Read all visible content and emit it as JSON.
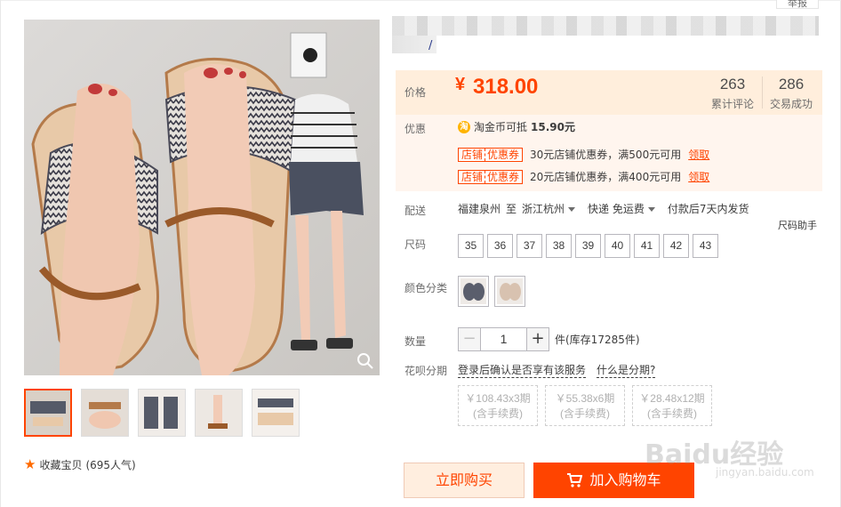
{
  "report": {
    "label": "举报"
  },
  "gallery": {
    "favorite_label": "收藏宝贝",
    "favorite_count": "(695人气)"
  },
  "price": {
    "label": "价格",
    "currency": "¥",
    "value": "318.00",
    "reviews_count": "263",
    "reviews_label": "累计评论",
    "sales_count": "286",
    "sales_label": "交易成功"
  },
  "promo": {
    "label": "优惠",
    "coin_icon_text": "淘",
    "coin_text": "淘金币可抵",
    "coin_amount": "15.90元",
    "coupons": [
      {
        "tag_a": "店铺",
        "tag_b": "优惠券",
        "text": "30元店铺优惠券，满500元可用",
        "action": "领取"
      },
      {
        "tag_a": "店铺",
        "tag_b": "优惠券",
        "text": "20元店铺优惠券，满400元可用",
        "action": "领取"
      }
    ]
  },
  "delivery": {
    "label": "配送",
    "from": "福建泉州",
    "to_word": "至",
    "to": "浙江杭州",
    "method": "快递 免运费",
    "ship_time": "付款后7天内发货",
    "size_helper": "尺码助手"
  },
  "sizes": {
    "label": "尺码",
    "options": [
      "35",
      "36",
      "37",
      "38",
      "39",
      "40",
      "41",
      "42",
      "43"
    ]
  },
  "colors": {
    "label": "颜色分类"
  },
  "quantity": {
    "label": "数量",
    "minus": "−",
    "value": "1",
    "plus": "+",
    "stock": "件(库存17285件)"
  },
  "huabei": {
    "label": "花呗分期",
    "login_text": "登录后确认是否享有该服务",
    "what_text": "什么是分期?",
    "plans": [
      {
        "amount": "￥108.43x3期",
        "fee": "(含手续费)"
      },
      {
        "amount": "￥55.38x6期",
        "fee": "(含手续费)"
      },
      {
        "amount": "￥28.48x12期",
        "fee": "(含手续费)"
      }
    ]
  },
  "actions": {
    "buy_now": "立即购买",
    "add_cart": "加入购物车"
  },
  "watermark": {
    "brand": "Baidu经验",
    "url": "jingyan.baidu.com"
  },
  "colors_theme": {
    "accent": "#ff4400",
    "price_bg": "#ffeedc"
  }
}
